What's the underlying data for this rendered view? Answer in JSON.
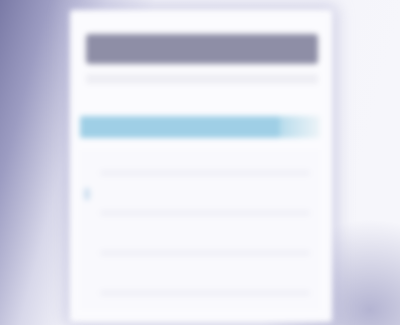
{
  "window": {
    "title": "",
    "header": ""
  },
  "colors": {
    "title_band": "#8e8ea6",
    "header_bar": "#9fcfe6",
    "window_bg": "#fbfbfe",
    "backdrop": "#7a7aa6"
  }
}
